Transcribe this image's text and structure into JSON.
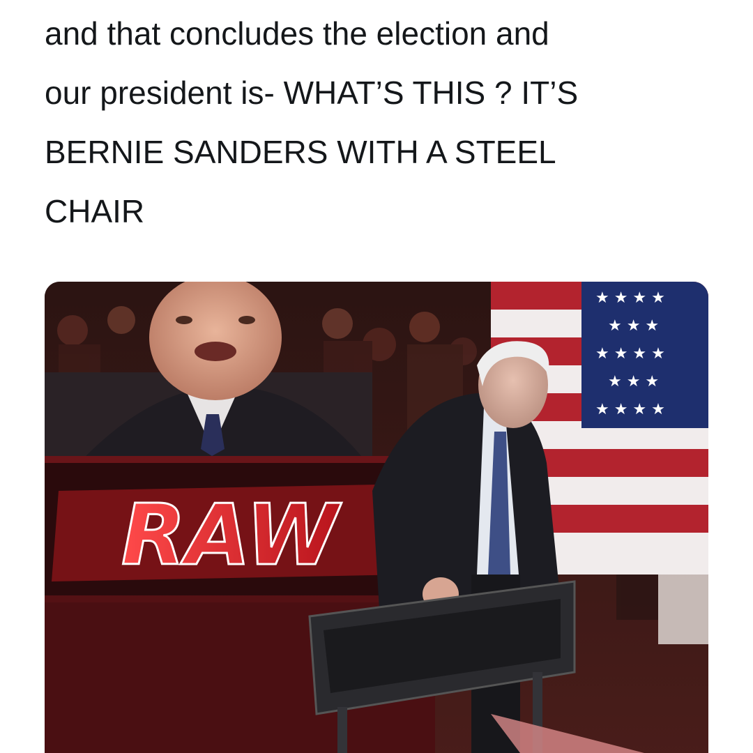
{
  "caption": {
    "lines": [
      "and that concludes the election and",
      "our president is- WHAT’S THIS ? IT’S",
      "BERNIE SANDERS WITH A STEEL",
      "CHAIR"
    ]
  },
  "media": {
    "logo_text": "RAW",
    "colors": {
      "crowd": "#3a1a18",
      "arena_red": "#c8202a",
      "suit": "#1c1c22",
      "flag_red": "#b3232e",
      "flag_blue": "#1e2f6e",
      "chair": "#2a2a2e"
    }
  }
}
